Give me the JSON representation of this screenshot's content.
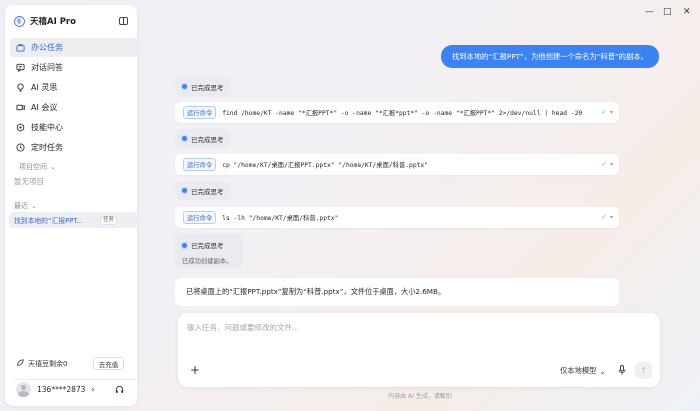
{
  "app": {
    "title": "天禧AI Pro"
  },
  "sidebar": {
    "nav": [
      {
        "label": "办公任务",
        "icon": "briefcase-icon"
      },
      {
        "label": "对话问答",
        "icon": "chat-icon"
      },
      {
        "label": "AI 灵思",
        "icon": "lightbulb-icon"
      },
      {
        "label": "AI 会议",
        "icon": "meeting-icon"
      },
      {
        "label": "技能中心",
        "icon": "skill-icon"
      },
      {
        "label": "定时任务",
        "icon": "clock-icon"
      }
    ],
    "project_section": "项目空间",
    "project_empty": "暂无项目",
    "recent_section": "最近",
    "recent_item": "找到本地的“汇报PPT...",
    "recent_tag": "任务",
    "credits": "天禧豆剩余0",
    "recharge": "去充值",
    "user": "136****2873"
  },
  "window": {
    "minimize": "—",
    "maximize": "□",
    "close": "✕"
  },
  "chat": {
    "user_message": "找到本地的“汇报PPT”，为他创建一个命名为“科普”的副本。",
    "thinking_label": "已完成思考",
    "run_label": "运行命令",
    "commands": [
      "find /home/KT -name \"*汇报PPT*\" -o -name \"*汇报*ppt*\" -o -name \"*汇报PPT*\" 2>/dev/null | head -20",
      "cp \"/home/KT/桌面/汇报PPT.pptx\" \"/home/KT/桌面/科普.pptx\"",
      "ls -lh \"/home/KT/桌面/科普.pptx\""
    ],
    "final_thinking_sub": "已成功创建副本。",
    "result": "已将桌面上的“汇报PPT.pptx”复制为“科普.pptx”，文件位于桌面，大小2.6MB。"
  },
  "composer": {
    "placeholder": "输入任务、问题或要修改的文件...",
    "model": "仅本地模型"
  },
  "footer": "内容由 AI 生成，请甄别",
  "colors": {
    "accent": "#3b82f6",
    "link": "#3a66e6"
  }
}
